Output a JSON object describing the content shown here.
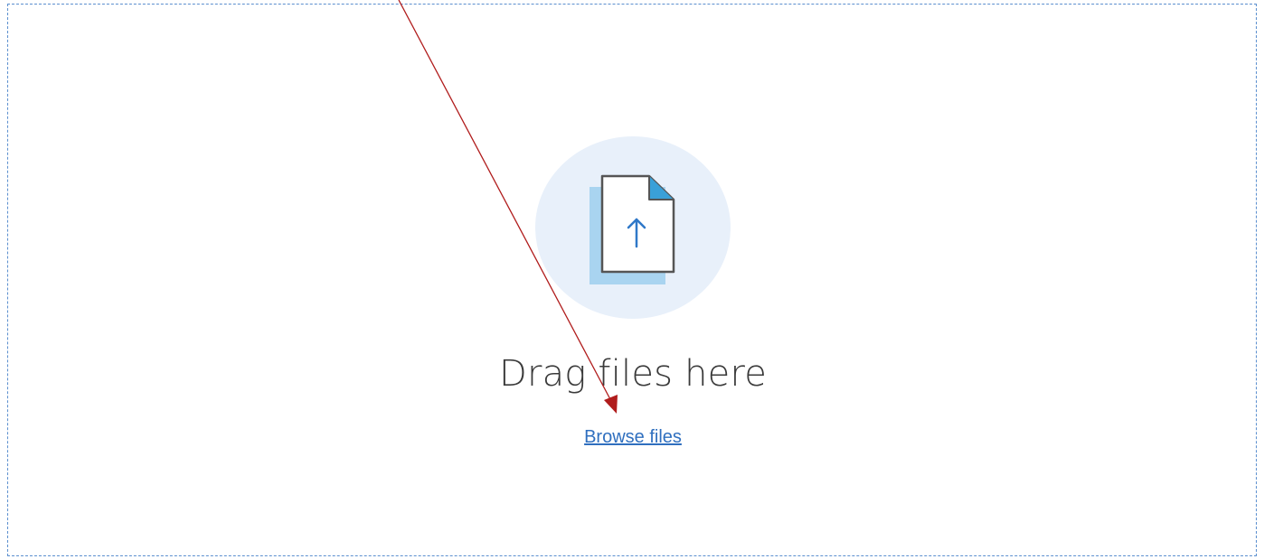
{
  "dropzone": {
    "headline": "Drag files here",
    "browse_label": "Browse files",
    "icon": "file-upload-icon"
  },
  "annotation": {
    "type": "arrow",
    "color": "#b01c1c"
  },
  "colors": {
    "border": "#5b8fcf",
    "circle": "#e8f0fa",
    "accent": "#3aa0d8",
    "link": "#2f6fbf",
    "arrow_icon": "#2f78c8"
  }
}
